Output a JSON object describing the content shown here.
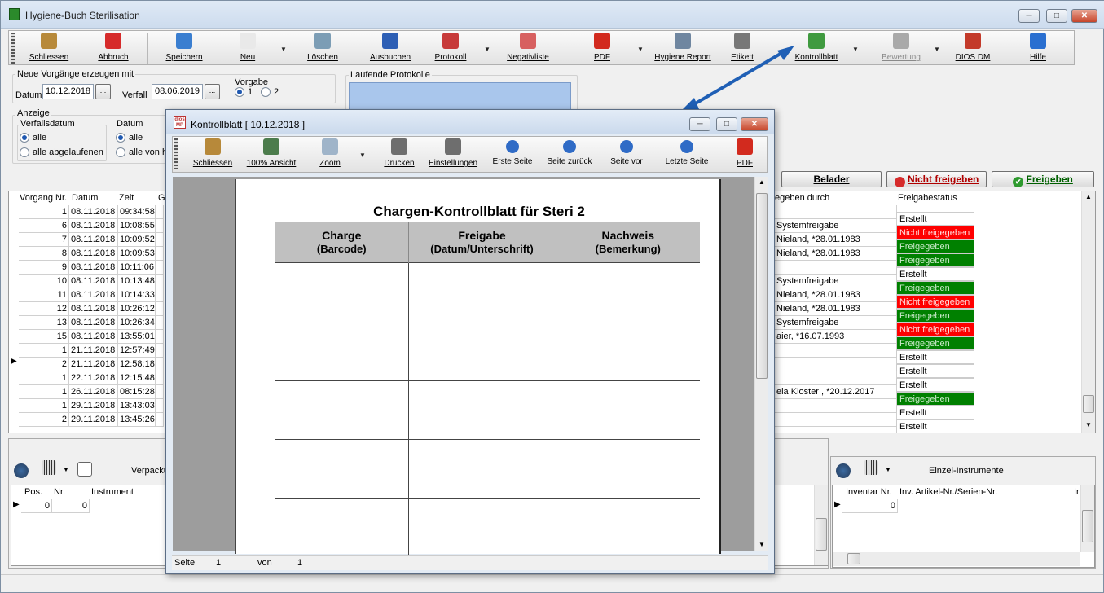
{
  "app": {
    "title": "Hygiene-Buch Sterilisation",
    "min": "─",
    "max": "□",
    "close": "✕"
  },
  "toolbar": [
    {
      "label": "Schliessen",
      "icon": "door-exit-icon",
      "color": "#b7893a"
    },
    {
      "label": "Abbruch",
      "icon": "cancel-icon",
      "color": "#d62b2b"
    },
    {
      "label": "Speichern",
      "icon": "save-icon",
      "color": "#3a7ed0"
    },
    {
      "label": "Neu",
      "icon": "new-document-icon",
      "color": "#e9e9e9"
    },
    {
      "label": "Löschen",
      "icon": "trash-icon",
      "color": "#7c9db5"
    },
    {
      "label": "Ausbuchen",
      "icon": "book-icon",
      "color": "#2d5fb5"
    },
    {
      "label": "Protokoll",
      "icon": "protocol-icon",
      "color": "#c73a3a"
    },
    {
      "label": "Negativliste",
      "icon": "list-icon",
      "color": "#d76060"
    },
    {
      "label": "PDF",
      "icon": "pdf-icon",
      "color": "#d22a1e"
    },
    {
      "label": "Hygiene Report",
      "icon": "report-icon",
      "color": "#6f86a0"
    },
    {
      "label": "Etikett",
      "icon": "barcode-printer-icon",
      "color": "#777777"
    },
    {
      "label": "Kontrollblatt",
      "icon": "checklist-icon",
      "color": "#3f9a3f"
    },
    {
      "label": "Bewertung",
      "icon": "bar-chart-icon",
      "color": "#a9a9a9"
    },
    {
      "label": "DIOS DM",
      "icon": "qm-icon",
      "color": "#c33a2a"
    },
    {
      "label": "Hilfe",
      "icon": "help-icon",
      "color": "#2a6fd0"
    }
  ],
  "form": {
    "neue_title": "Neue Vorgänge erzeugen mit",
    "datum_label": "Datum",
    "datum_value": "10.12.2018",
    "verfall_label": "Verfall",
    "verfall_value": "08.06.2019",
    "vorgabe_label": "Vorgabe",
    "vorgabe_1": "1",
    "vorgabe_2": "2",
    "laufende_title": "Laufende Protokolle",
    "anzeige_title": "Anzeige",
    "verfallsdatum_title": "Verfallsdatum",
    "alle": "alle",
    "alle_abgelaufenen": "alle abgelaufenen",
    "datum_title": "Datum",
    "datum_alle": "alle",
    "datum_alle_von": "alle von h",
    "dots": "..."
  },
  "buttons": {
    "belader": "Belader",
    "nicht_freigeben": "Nicht freigeben",
    "freigeben": "Freigeben"
  },
  "grid": {
    "headers": {
      "vorgang": "Vorgang Nr.",
      "datum": "Datum",
      "zeit": "Zeit",
      "ge": "Ge",
      "freigegeben_durch": "egeben durch",
      "freigabestatus": "Freigabestatus"
    },
    "rows": [
      {
        "nr": "1",
        "datum": "08.11.2018",
        "zeit": "09:34:58",
        "by": "",
        "status": "Erstellt",
        "s": "w"
      },
      {
        "nr": "6",
        "datum": "08.11.2018",
        "zeit": "10:08:55",
        "by": "Systemfreigabe",
        "status": "Nicht freigegeben",
        "s": "r"
      },
      {
        "nr": "7",
        "datum": "08.11.2018",
        "zeit": "10:09:52",
        "by": "Nieland, *28.01.1983",
        "status": "Freigegeben",
        "s": "g"
      },
      {
        "nr": "8",
        "datum": "08.11.2018",
        "zeit": "10:09:53",
        "by": "Nieland, *28.01.1983",
        "status": "Freigegeben",
        "s": "g"
      },
      {
        "nr": "9",
        "datum": "08.11.2018",
        "zeit": "10:11:06",
        "by": "",
        "status": "Erstellt",
        "s": "w"
      },
      {
        "nr": "10",
        "datum": "08.11.2018",
        "zeit": "10:13:48",
        "by": "Systemfreigabe",
        "status": "Freigegeben",
        "s": "g"
      },
      {
        "nr": "11",
        "datum": "08.11.2018",
        "zeit": "10:14:33",
        "by": "Nieland, *28.01.1983",
        "status": "Nicht freigegeben",
        "s": "r"
      },
      {
        "nr": "12",
        "datum": "08.11.2018",
        "zeit": "10:26:12",
        "by": "Nieland, *28.01.1983",
        "status": "Freigegeben",
        "s": "g"
      },
      {
        "nr": "13",
        "datum": "08.11.2018",
        "zeit": "10:26:34",
        "by": "Systemfreigabe",
        "status": "Nicht freigegeben",
        "s": "r"
      },
      {
        "nr": "15",
        "datum": "08.11.2018",
        "zeit": "13:55:01",
        "by": "aier, *16.07.1993",
        "status": "Freigegeben",
        "s": "g"
      },
      {
        "nr": "1",
        "datum": "21.11.2018",
        "zeit": "12:57:49",
        "by": "",
        "status": "Erstellt",
        "s": "w"
      },
      {
        "nr": "2",
        "datum": "21.11.2018",
        "zeit": "12:58:18",
        "by": "",
        "status": "Erstellt",
        "s": "w"
      },
      {
        "nr": "1",
        "datum": "22.11.2018",
        "zeit": "12:15:48",
        "by": "",
        "status": "Erstellt",
        "s": "w"
      },
      {
        "nr": "1",
        "datum": "26.11.2018",
        "zeit": "08:15:28",
        "by": "ela  Kloster , *20.12.2017",
        "status": "Freigegeben",
        "s": "g"
      },
      {
        "nr": "1",
        "datum": "29.11.2018",
        "zeit": "13:43:03",
        "by": "",
        "status": "Erstellt",
        "s": "w"
      },
      {
        "nr": "2",
        "datum": "29.11.2018",
        "zeit": "13:45:26",
        "by": "",
        "status": "Erstellt",
        "s": "w"
      }
    ]
  },
  "bottom": {
    "verpackung_label": "Verpacku",
    "einzel_label": "Einzel-Instrumente",
    "left_headers": {
      "pos": "Pos.",
      "nr": "Nr.",
      "instrument": "Instrument"
    },
    "left_row": {
      "pos": "0",
      "nr": "0"
    },
    "right_headers": {
      "inventar": "Inventar Nr.",
      "artikel": "Inv. Artikel-Nr./Serien-Nr.",
      "in": "In"
    },
    "right_row": {
      "inventar": "0"
    }
  },
  "popup": {
    "title": "Kontrollblatt [ 10.12.2018 ]",
    "toolbar": [
      {
        "label": "Schliessen",
        "icon": "door-exit-icon",
        "color": "#b7893a"
      },
      {
        "label": "100% Ansicht",
        "icon": "zoom-100-icon",
        "color": "#4c7c4c"
      },
      {
        "label": "Zoom",
        "icon": "zoom-icon",
        "color": "#9fb4c9"
      },
      {
        "label": "Drucken",
        "icon": "printer-icon",
        "color": "#6e6e6e"
      },
      {
        "label": "Einstellungen",
        "icon": "printer-settings-icon",
        "color": "#6e6e6e"
      },
      {
        "label": "Erste Seite",
        "icon": "first-page-icon",
        "color": "#2f6bc6"
      },
      {
        "label": "Seite zurück",
        "icon": "prev-page-icon",
        "color": "#2f6bc6"
      },
      {
        "label": "Seite vor",
        "icon": "next-page-icon",
        "color": "#2f6bc6"
      },
      {
        "label": "Letzte Seite",
        "icon": "last-page-icon",
        "color": "#2f6bc6"
      },
      {
        "label": "PDF",
        "icon": "pdf-icon",
        "color": "#d22a1e"
      }
    ],
    "doc_title": "Chargen-Kontrollblatt für Steri 2",
    "col1": "Charge",
    "col1_sub": "(Barcode)",
    "col2": "Freigabe",
    "col2_sub": "(Datum/Unterschrift)",
    "col3": "Nachweis",
    "col3_sub": "(Bemerkung)",
    "status_seite": "Seite",
    "status_page": "1",
    "status_von": "von",
    "status_total": "1"
  }
}
